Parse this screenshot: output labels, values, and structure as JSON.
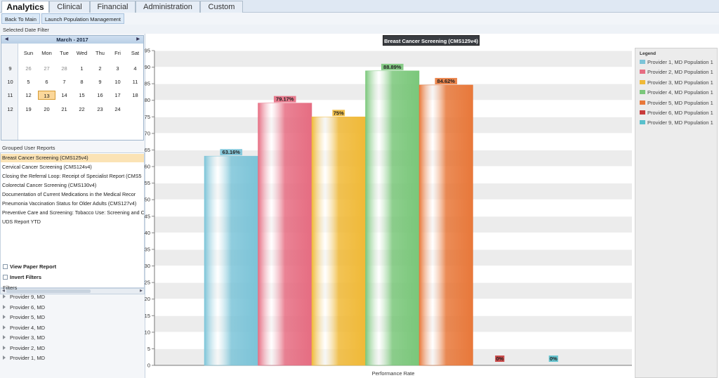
{
  "tabs": [
    {
      "label": "Analytics",
      "active": true
    },
    {
      "label": "Clinical",
      "active": false
    },
    {
      "label": "Financial",
      "active": false
    },
    {
      "label": "Administration",
      "active": false
    },
    {
      "label": "Custom",
      "active": false
    }
  ],
  "toolbar": {
    "back_label": "Back To Main",
    "launch_label": "Launch Population Management"
  },
  "date_filter_label": "Selected Date Filter",
  "calendar": {
    "month_label": "March - 2017",
    "weekdays": [
      "Sun",
      "Mon",
      "Tue",
      "Wed",
      "Thu",
      "Fri",
      "Sat"
    ],
    "weeks": [
      {
        "num": "9",
        "days": [
          "26",
          "27",
          "28",
          "1",
          "2",
          "3",
          "4"
        ]
      },
      {
        "num": "10",
        "days": [
          "5",
          "6",
          "7",
          "8",
          "9",
          "10",
          "11"
        ]
      },
      {
        "num": "11",
        "days": [
          "12",
          "13",
          "14",
          "15",
          "16",
          "17",
          "18"
        ]
      },
      {
        "num": "12",
        "days": [
          "19",
          "20",
          "21",
          "22",
          "23",
          "24",
          ""
        ]
      }
    ],
    "selected_day": "13"
  },
  "reports_label": "Grouped User Reports",
  "reports": [
    "Breast Cancer Screening (CMS125v4)",
    "Cervical Cancer Screening (CMS124v4)",
    "Closing the Referral Loop: Receipt of Specialist Report (CMS5",
    "Colorectal Cancer Screening (CMS130v4)",
    "Documentation of Current Medications in the Medical Recor",
    "Pneumonia Vaccination Status for Older Adults (CMS127v4)",
    "Preventive Care and Screening: Tobacco Use: Screening and C",
    "UDS Report YTD"
  ],
  "view_paper_label": "View Paper Report",
  "invert_filters_label": "Invert Filters",
  "filters_label": "Filters",
  "providers": [
    "Provider 9, MD",
    "Provider 6, MD",
    "Provider 5, MD",
    "Provider 4, MD",
    "Provider 3, MD",
    "Provider 2, MD",
    "Provider 1, MD"
  ],
  "chart_data": {
    "type": "bar",
    "title": "Breast Cancer Screening (CMS125v4)",
    "xlabel": "Performance Rate",
    "ylabel": "",
    "ylim": [
      0,
      95
    ],
    "yticks": [
      "0",
      "5",
      "10",
      "15",
      "20",
      "25",
      "30",
      "35",
      "40",
      "45",
      "50",
      "55",
      "60",
      "65",
      "70",
      "75",
      "80",
      "85",
      "90",
      "95"
    ],
    "grid": true,
    "legend_title": "Legend",
    "legend_position": "right",
    "series": [
      {
        "name": "Provider 1, MD Population 1",
        "value": 63.16,
        "label": "63.16%",
        "color": "#7cc4d8"
      },
      {
        "name": "Provider 2, MD Population 1",
        "value": 79.17,
        "label": "79.17%",
        "color": "#e66d82"
      },
      {
        "name": "Provider 3, MD Population 1",
        "value": 75,
        "label": "75%",
        "color": "#f0b937"
      },
      {
        "name": "Provider 4, MD Population 1",
        "value": 88.89,
        "label": "88.89%",
        "color": "#7ac77a"
      },
      {
        "name": "Provider 5, MD Population 1",
        "value": 84.62,
        "label": "84.62%",
        "color": "#e8783a"
      },
      {
        "name": "Provider 6, MD Population 1",
        "value": 0,
        "label": "0%",
        "color": "#c83a3a"
      },
      {
        "name": "Provider 9, MD Population 1",
        "value": 0,
        "label": "0%",
        "color": "#58c0cc"
      }
    ]
  }
}
